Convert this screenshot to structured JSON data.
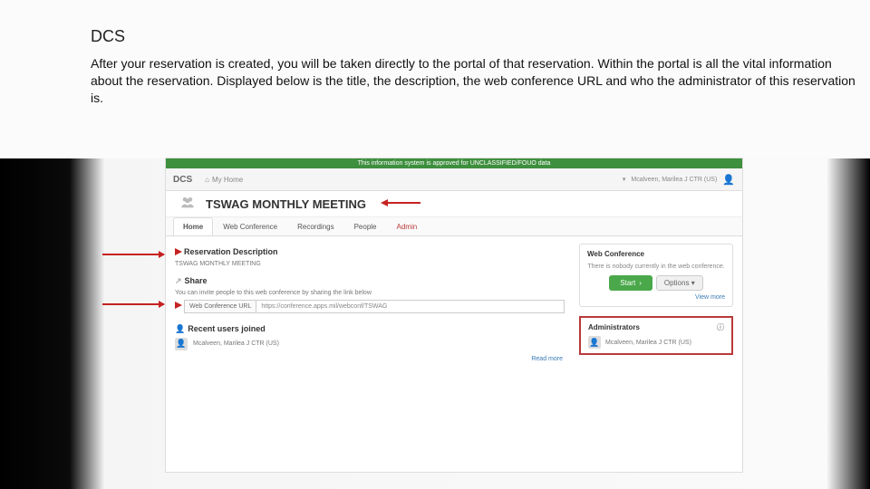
{
  "slide": {
    "heading": "DCS",
    "paragraph": "After your reservation is created, you will be taken directly to the portal of that reservation. Within the portal is all the vital information about the reservation. Displayed below is the title, the description, the web conference URL and who the administrator of this reservation is."
  },
  "banner": "This information system is approved for UNCLASSIFIED/FOUO data",
  "nav": {
    "brand": "DCS",
    "home": "My Home",
    "user": "Mcalveen, Marilea J CTR (US)"
  },
  "meeting_title": "TSWAG MONTHLY MEETING",
  "tabs": {
    "home": "Home",
    "web": "Web Conference",
    "rec": "Recordings",
    "people": "People",
    "admin": "Admin"
  },
  "reservation": {
    "title": "Reservation Description",
    "value": "TSWAG MONTHLY MEETING"
  },
  "share": {
    "title": "Share",
    "desc": "You can invite people to this web conference by sharing the link below",
    "label": "Web Conference URL",
    "url": "https://conference.apps.mil/webconf/TSWAG"
  },
  "recent": {
    "title": "Recent users joined",
    "user": "Mcalveen, Marilea J CTR (US)",
    "readmore": "Read more"
  },
  "webconf": {
    "title": "Web Conference",
    "empty": "There is nobody currently in the web conference.",
    "start": "Start",
    "options": "Options",
    "more": "View more"
  },
  "admins": {
    "title": "Administrators",
    "user": "Mcalveen, Marilea J CTR (US)"
  }
}
